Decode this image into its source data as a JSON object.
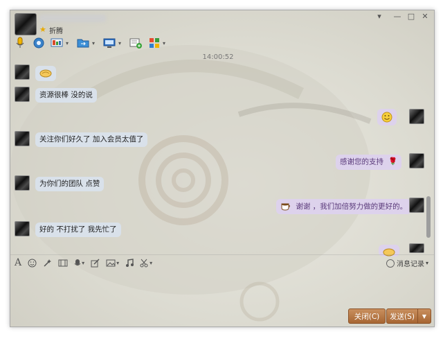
{
  "header": {
    "status_text": "折腾",
    "star_icon": "star-icon",
    "window_controls": [
      "▾",
      "—",
      "□",
      "✕"
    ]
  },
  "toolbar_icons": [
    "microphone-icon",
    "video-icon",
    "screen-share-icon",
    "file-transfer-icon",
    "remote-desktop-icon",
    "invite-icon",
    "apps-grid-icon"
  ],
  "chat": {
    "timestamp": "14:00:52",
    "messages": [
      {
        "side": "left",
        "text": "",
        "emoji": "handshake"
      },
      {
        "side": "left",
        "text": "资源很棒 没的说"
      },
      {
        "side": "right",
        "text": "",
        "emoji": "smile"
      },
      {
        "side": "left",
        "text": "关注你们好久了 加入会员太值了"
      },
      {
        "side": "right",
        "text": "感谢您的支持",
        "emoji": "rose"
      },
      {
        "side": "left",
        "text": "为你们的团队 点赞"
      },
      {
        "side": "right",
        "text": "谢谢 ，我们加倍努力做的更好的。",
        "emoji": "coffee"
      },
      {
        "side": "left",
        "text": "好的 不打扰了 我先忙了"
      },
      {
        "side": "right",
        "text": "",
        "emoji": "handshake"
      }
    ]
  },
  "input_toolbar": {
    "font_label": "A",
    "history_label": "消息记录",
    "history_dropdown": "▾"
  },
  "buttons": {
    "close": "关闭(C)",
    "send": "发送(S)",
    "send_dropdown": "▼"
  },
  "colors": {
    "accent": "#b8773f",
    "bubble_left": "#d9e1ea",
    "bubble_right": "#ddd2ec"
  }
}
